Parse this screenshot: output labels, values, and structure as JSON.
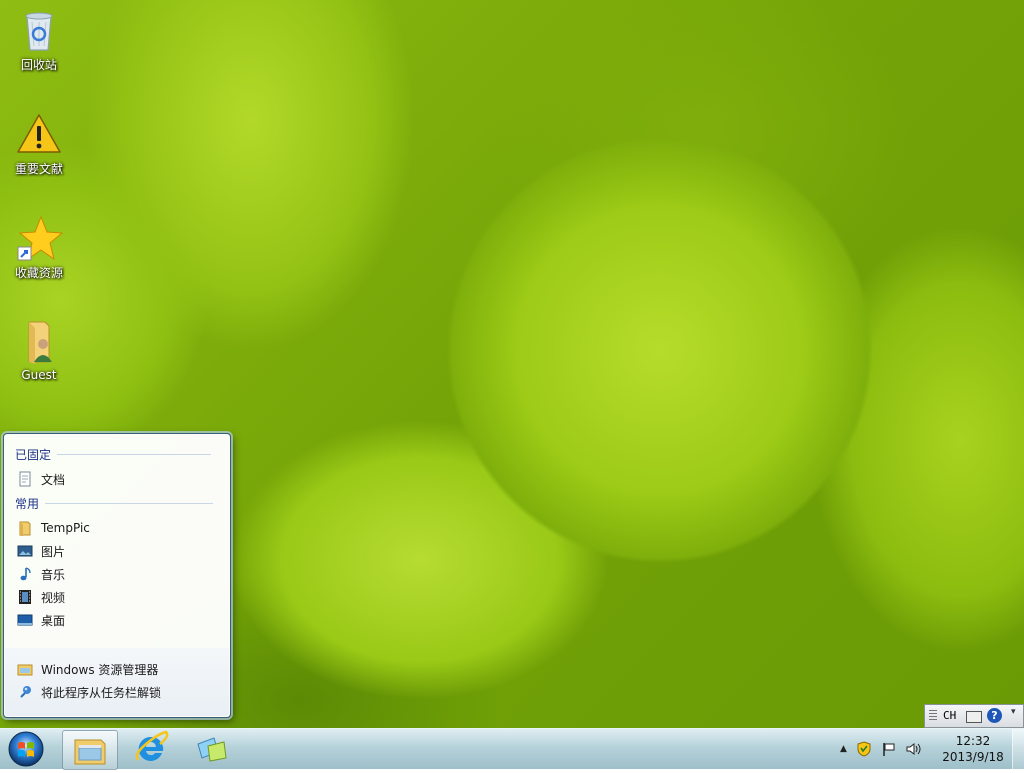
{
  "desktop": {
    "icons": [
      {
        "label": "回收站",
        "icon": "recycle-bin-icon"
      },
      {
        "label": "重要文献",
        "icon": "warning-icon"
      },
      {
        "label": "收藏资源",
        "icon": "star-shortcut-icon"
      },
      {
        "label": "Guest",
        "icon": "user-folder-icon"
      }
    ]
  },
  "jumplist": {
    "pinned_header": "已固定",
    "pinned": [
      {
        "label": "文档",
        "icon": "document-icon"
      }
    ],
    "frequent_header": "常用",
    "frequent": [
      {
        "label": "TempPic",
        "icon": "folder-icon"
      },
      {
        "label": "图片",
        "icon": "pictures-icon"
      },
      {
        "label": "音乐",
        "icon": "music-icon"
      },
      {
        "label": "视频",
        "icon": "video-icon"
      },
      {
        "label": "桌面",
        "icon": "desktop-icon"
      }
    ],
    "tasks": [
      {
        "label": "Windows 资源管理器",
        "icon": "explorer-icon"
      },
      {
        "label": "将此程序从任务栏解锁",
        "icon": "unpin-icon"
      }
    ]
  },
  "taskbar": {
    "buttons": [
      {
        "name": "start-button",
        "icon": "windows-orb-icon"
      },
      {
        "name": "explorer",
        "icon": "explorer-icon",
        "active": true
      },
      {
        "name": "internet-explorer",
        "icon": "ie-icon"
      },
      {
        "name": "windows-sidebar",
        "icon": "stacked-windows-icon"
      }
    ],
    "clock": {
      "time": "12:32",
      "date": "2013/9/18"
    }
  },
  "langbar": {
    "language": "CH"
  },
  "colors": {
    "accent": "#1e3287",
    "taskbar": "#b6d2da",
    "desktop_green": "#9dcb17"
  }
}
